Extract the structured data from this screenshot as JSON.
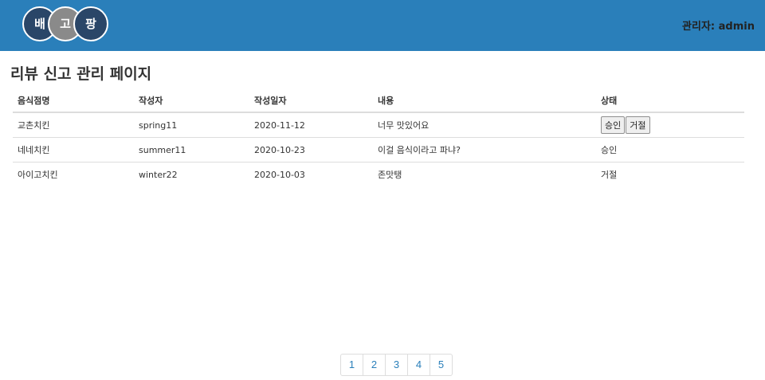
{
  "header": {
    "logo": [
      "배",
      "고",
      "팡"
    ],
    "admin_label": "관리자: admin"
  },
  "page_title": "리뷰 신고 관리 페이지",
  "table": {
    "columns": [
      "음식점명",
      "작성자",
      "작성일자",
      "내용",
      "상태"
    ],
    "rows": [
      {
        "restaurant": "교촌치킨",
        "author": "spring11",
        "date": "2020-11-12",
        "content": "너무 맛있어요",
        "status": null,
        "approve_label": "승인",
        "reject_label": "거절"
      },
      {
        "restaurant": "네네치킨",
        "author": "summer11",
        "date": "2020-10-23",
        "content": "이걸 음식이라고 파냐?",
        "status": "승인"
      },
      {
        "restaurant": "아이고치킨",
        "author": "winter22",
        "date": "2020-10-03",
        "content": "존맛탱",
        "status": "거절"
      }
    ]
  },
  "pagination": [
    "1",
    "2",
    "3",
    "4",
    "5"
  ],
  "colors": {
    "header_bg": "#2a7fba",
    "logo_dark": "#2a4668",
    "logo_gray": "#8a8a8a",
    "link": "#2a7fba"
  }
}
